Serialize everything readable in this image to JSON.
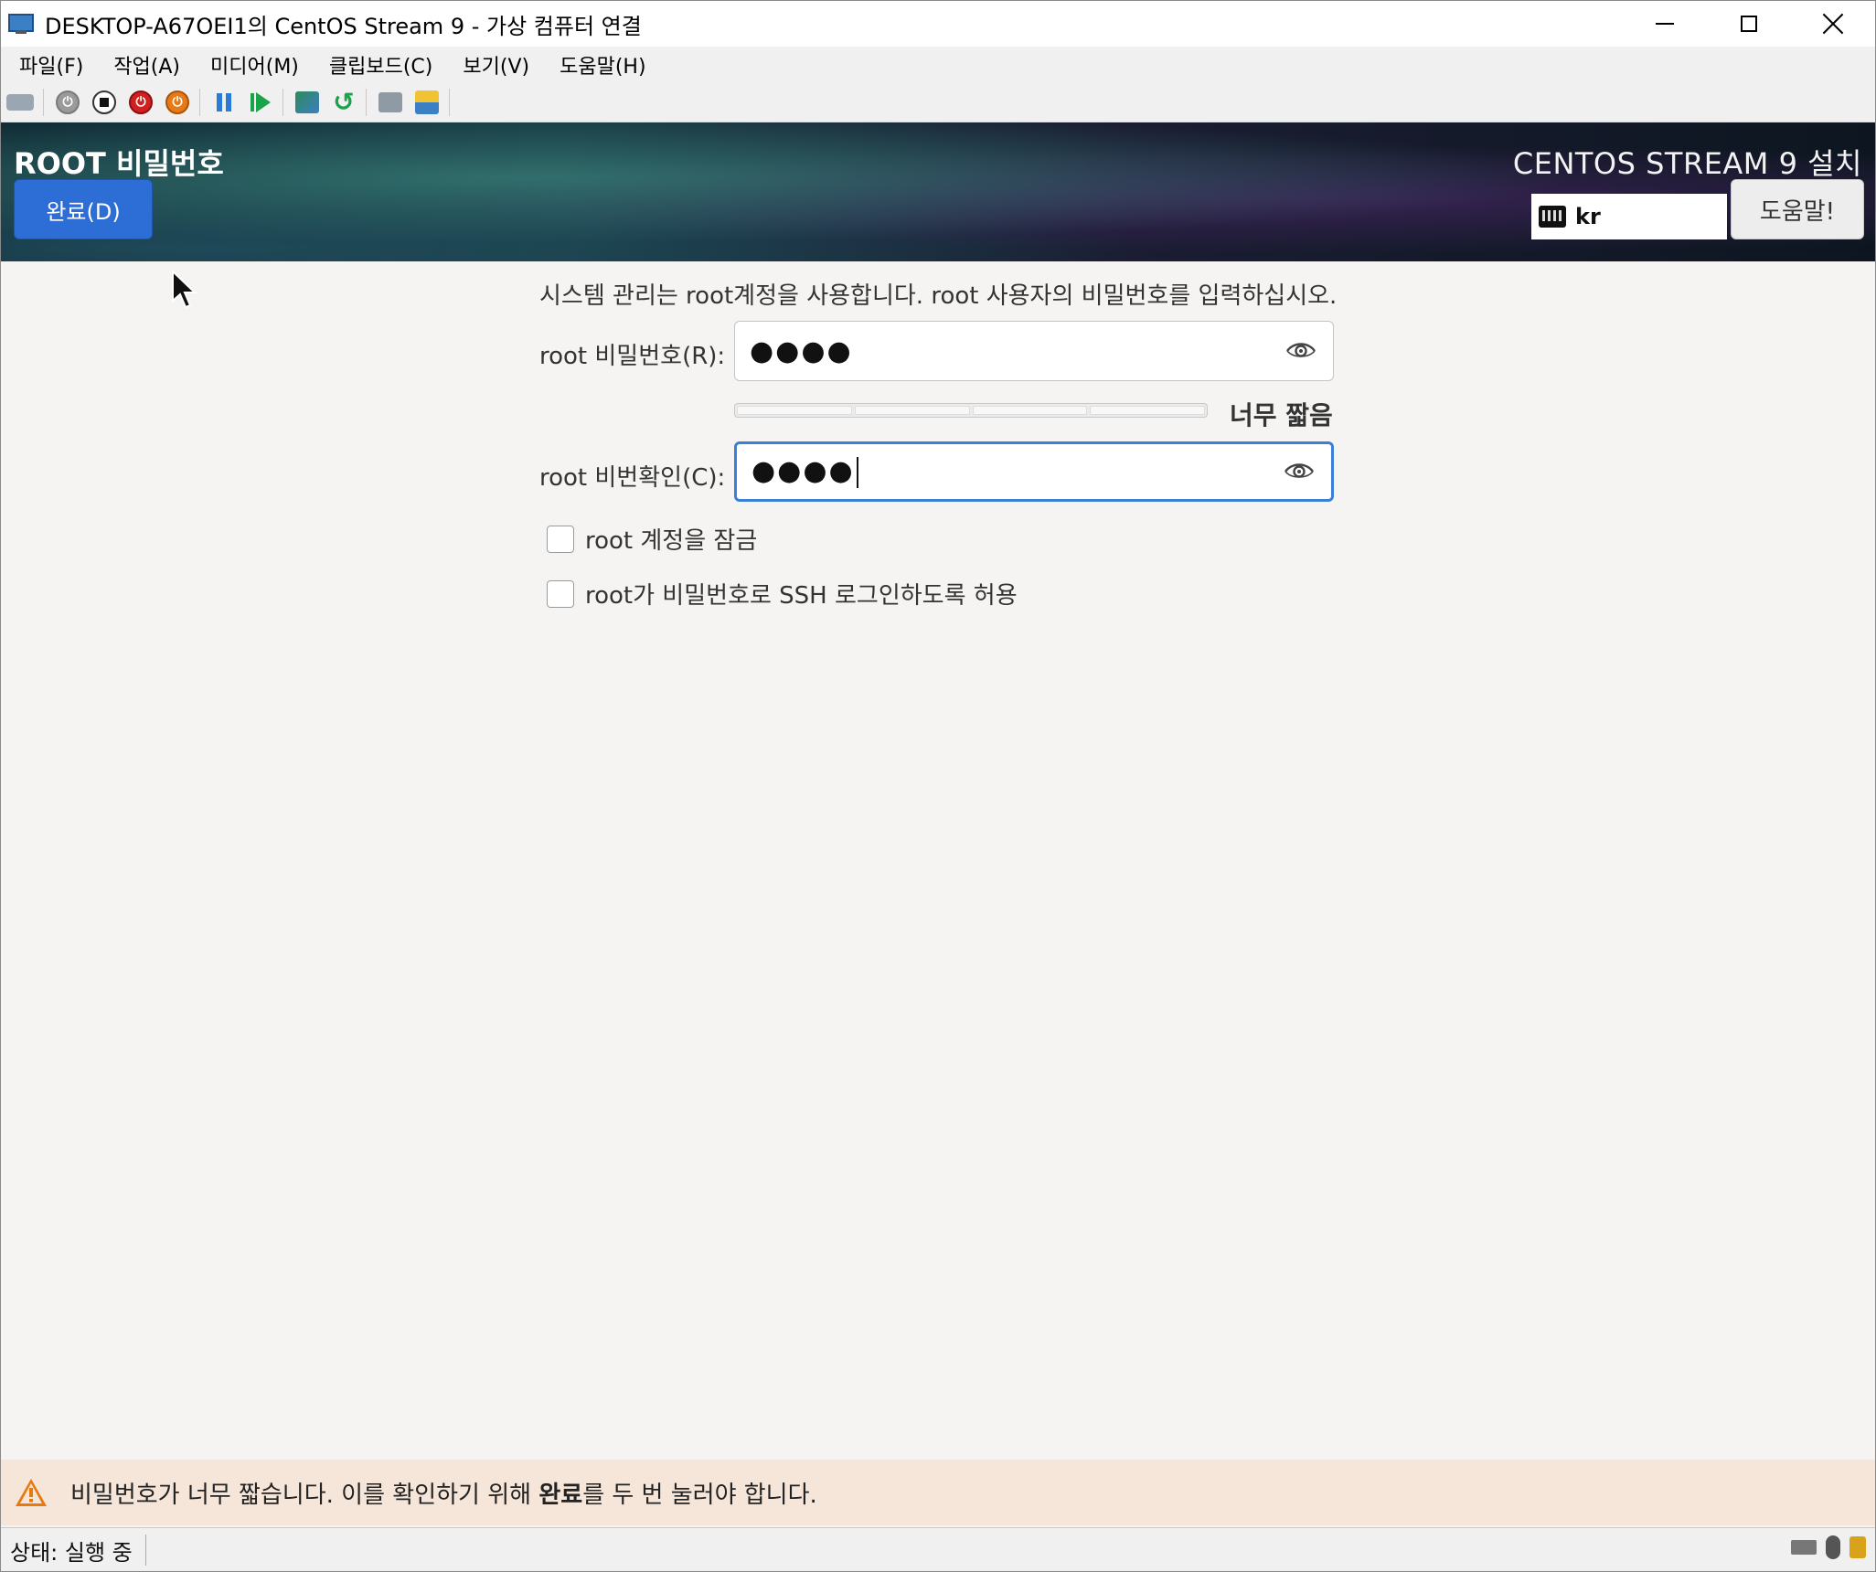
{
  "window": {
    "title": "DESKTOP-A67OEI1의 CentOS Stream 9 - 가상 컴퓨터 연결"
  },
  "menubar": {
    "items": [
      {
        "label": "파일(F)"
      },
      {
        "label": "작업(A)"
      },
      {
        "label": "미디어(M)"
      },
      {
        "label": "클립보드(C)"
      },
      {
        "label": "보기(V)"
      },
      {
        "label": "도움말(H)"
      }
    ]
  },
  "toolbar": {
    "icons": [
      "ctrl-alt-del-icon",
      "start-icon",
      "turn-off-icon",
      "shutdown-icon",
      "save-state-icon",
      "pause-icon",
      "resume-icon",
      "checkpoint-icon",
      "revert-icon",
      "enhanced-session-icon",
      "share-icon"
    ]
  },
  "header": {
    "spoke_title": "ROOT 비밀번호",
    "done_label": "완료(D)",
    "product_title": "CENTOS STREAM 9 설치",
    "keyboard_layout": "kr",
    "help_label": "도움말!"
  },
  "form": {
    "intro": "시스템 관리는 root계정을 사용합니다. root 사용자의 비밀번호를 입력하십시오.",
    "password_label": "root 비밀번호(R):",
    "password_value": "●●●●",
    "strength_text": "너무 짧음",
    "confirm_label": "root 비번확인(C):",
    "confirm_value": "●●●●",
    "lock_root_label": "root 계정을 잠금",
    "allow_ssh_label": "root가 비밀번호로 SSH 로그인하도록 허용",
    "lock_root_checked": false,
    "allow_ssh_checked": false,
    "strength_level": 0
  },
  "warning": {
    "text_before": "비밀번호가 너무 짧습니다. 이를 확인하기 위해 ",
    "text_bold": "완료",
    "text_after": "를 두 번 눌러야 합니다."
  },
  "status": {
    "text": "상태: 실행 중"
  },
  "colors": {
    "accent": "#2c6ed5",
    "focus": "#3b7fd6",
    "warning_bg": "#f6e6d9",
    "warning_icon": "#e8790f"
  }
}
